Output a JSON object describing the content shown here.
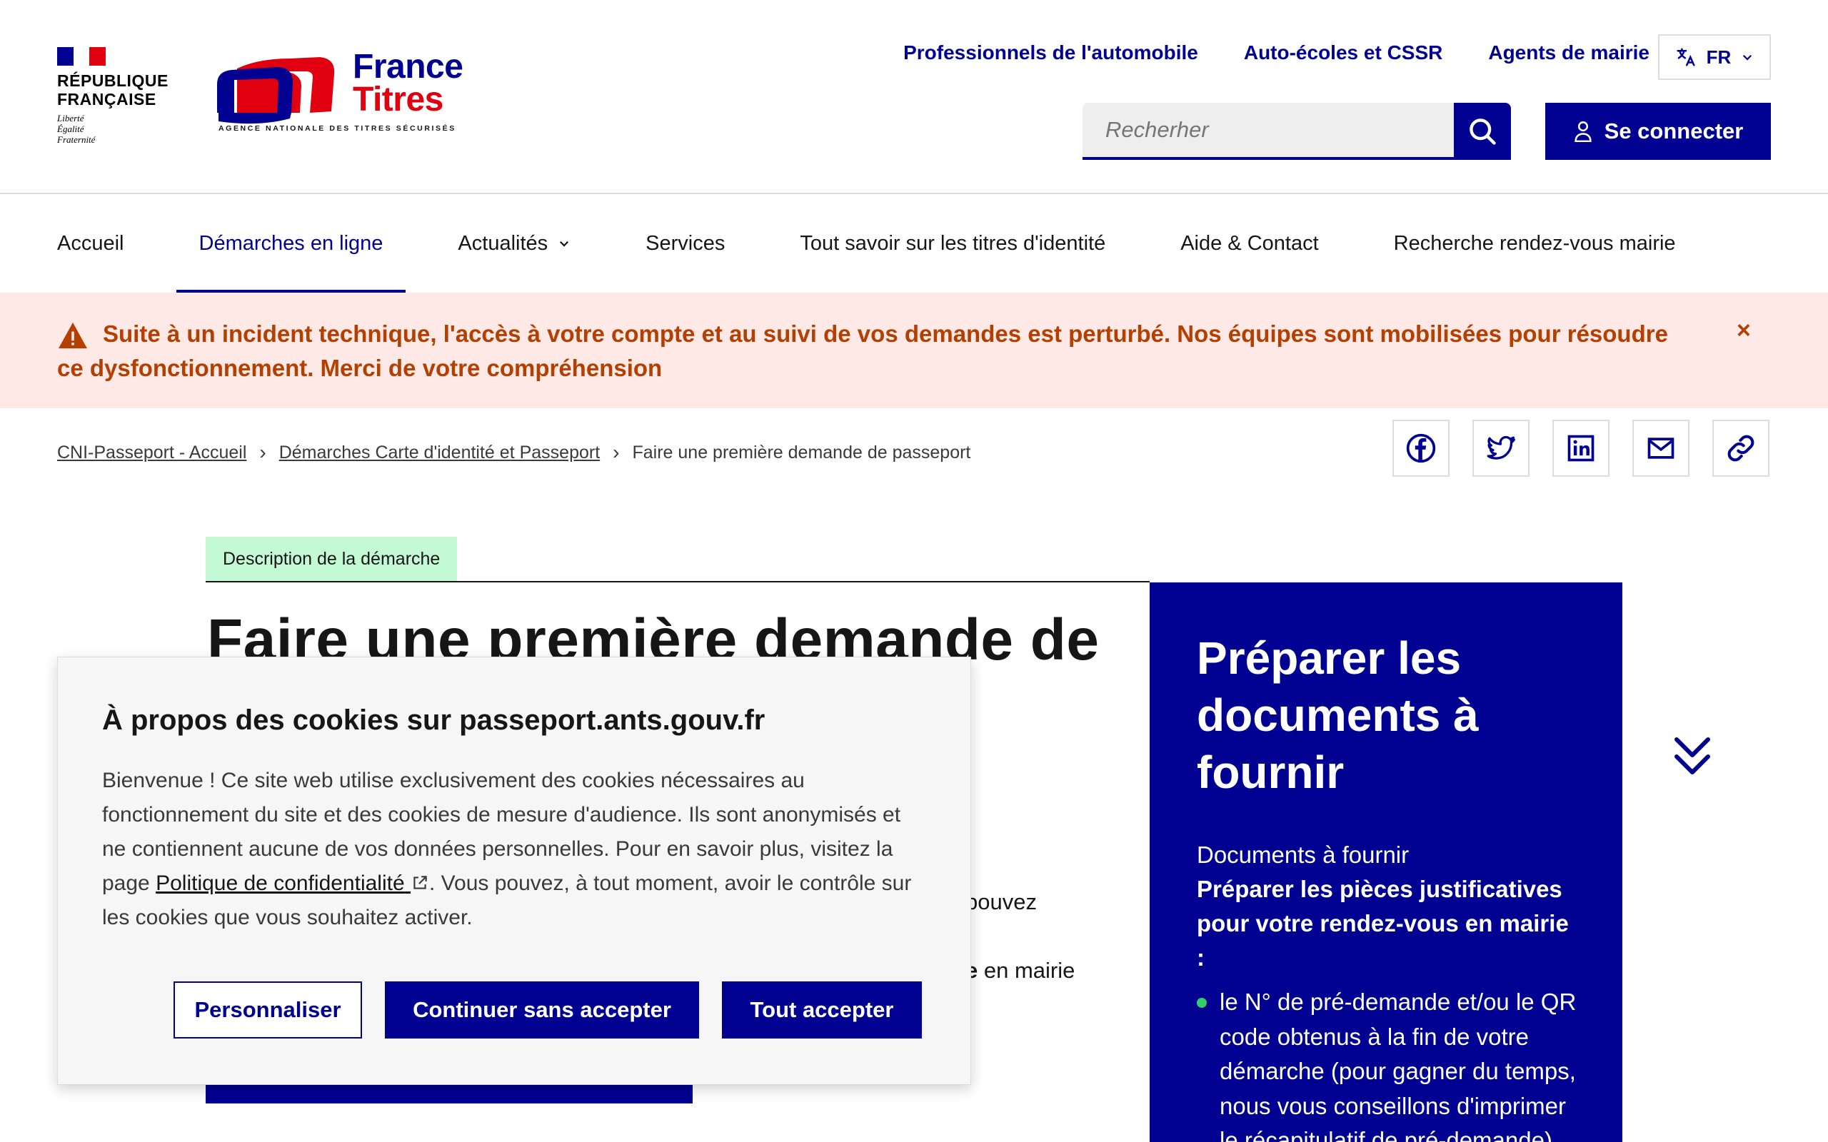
{
  "brand": {
    "republic_line1": "RÉPUBLIQUE",
    "republic_line2": "FRANÇAISE",
    "motto1": "Liberté",
    "motto2": "Égalité",
    "motto3": "Fraternité",
    "france": "France",
    "titres": "Titres",
    "tagline": "AGENCE NATIONALE DES TITRES SÉCURISÉS",
    "colors": {
      "blue": "#000091",
      "red": "#e1000f"
    }
  },
  "header": {
    "links": [
      "Professionnels de l'automobile",
      "Auto-écoles et CSSR",
      "Agents de mairie"
    ],
    "language": "FR",
    "search_placeholder": "Recherher",
    "login_label": "Se connecter"
  },
  "nav": {
    "items": [
      {
        "label": "Accueil",
        "active": false
      },
      {
        "label": "Démarches en ligne",
        "active": true
      },
      {
        "label": "Actualités",
        "active": false,
        "dropdown": true
      },
      {
        "label": "Services",
        "active": false
      },
      {
        "label": "Tout savoir sur les titres d'identité",
        "active": false
      },
      {
        "label": "Aide & Contact",
        "active": false
      },
      {
        "label": "Recherche rendez-vous mairie",
        "active": false
      }
    ]
  },
  "alert": {
    "text": "Suite à un incident technique, l'accès à votre compte et au suivi de vos demandes est perturbé. Nos équipes sont mobilisées pour résoudre ce dysfonctionnement. Merci de votre compréhension",
    "close": "×",
    "color": "#b34000"
  },
  "breadcrumb": {
    "items": [
      "CNI-Passeport - Accueil",
      "Démarches Carte d'identité et Passeport"
    ],
    "current": "Faire une première demande de passeport"
  },
  "share": {
    "icons": [
      "facebook-icon",
      "twitter-icon",
      "linkedin-icon",
      "mail-icon",
      "link-icon"
    ]
  },
  "main": {
    "tag": "Description de la démarche",
    "title": "Faire une première demande de",
    "frag1": "pouvez",
    "frag2_bold": "e",
    "frag2_rest": " en mairie"
  },
  "panel": {
    "title": "Préparer les documents à fournir",
    "subtitle": "Documents à fournir",
    "strong": "Préparer les pièces justificatives pour votre rendez-vous en mairie :",
    "item1": "le N° de pré-demande et/ou le QR code obtenus à la fin de votre démarche (pour gagner du temps, nous vous conseillons d'imprimer le récapitulatif de pré-demande)"
  },
  "cookie": {
    "title": "À propos des cookies sur passeport.ants.gouv.fr",
    "body_part1": "Bienvenue ! Ce site web utilise exclusivement des cookies nécessaires au fonctionnement du site et des cookies de mesure d'audience. Ils sont anonymisés et ne contiennent aucune de vos données personnelles. Pour en savoir plus, visitez la page ",
    "link": "Politique de confidentialité",
    "body_part2": ". Vous pouvez, à tout moment, avoir le contrôle sur les cookies que vous souhaitez activer.",
    "btn_customize": "Personnaliser",
    "btn_decline": "Continuer sans accepter",
    "btn_accept": "Tout accepter"
  }
}
